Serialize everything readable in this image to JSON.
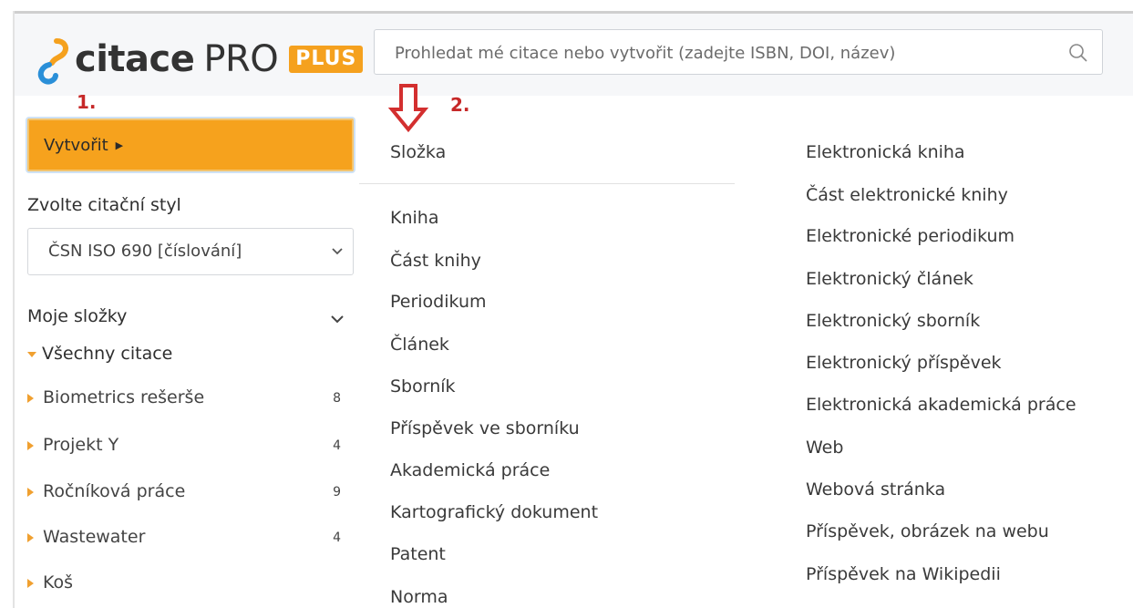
{
  "header": {
    "logo": {
      "name": "citace",
      "pro": "PRO",
      "badge": "PLUS"
    },
    "search": {
      "placeholder": "Prohledat mé citace nebo vytvořit (zadejte ISBN, DOI, název)"
    }
  },
  "annotations": {
    "step1": "1.",
    "step2": "2."
  },
  "sidebar": {
    "create_button": "Vytvořit",
    "style_label": "Zvolte citační styl",
    "style_value": "ČSN ISO 690 [číslování]",
    "folders_label": "Moje složky",
    "all_citations": "Všechny citace",
    "folders": [
      {
        "name": "Biometrics rešerše",
        "count": "8"
      },
      {
        "name": "Projekt Y",
        "count": "4"
      },
      {
        "name": "Ročníková práce",
        "count": "9"
      },
      {
        "name": "Wastewater",
        "count": "4"
      },
      {
        "name": "Koš",
        "count": ""
      }
    ]
  },
  "menu": {
    "folder": "Složka",
    "left": [
      "Kniha",
      "Část knihy",
      "Periodikum",
      "Článek",
      "Sborník",
      "Příspěvek ve sborníku",
      "Akademická práce",
      "Kartografický dokument",
      "Patent",
      "Norma"
    ],
    "right": [
      "Elektronická kniha",
      "Část elektronické knihy",
      "Elektronické periodikum",
      "Elektronický článek",
      "Elektronický sborník",
      "Elektronický příspěvek",
      "Elektronická akademická práce",
      "Web",
      "Webová stránka",
      "Příspěvek, obrázek na webu",
      "Příspěvek na Wikipedii"
    ]
  },
  "colors": {
    "accent": "#f6a21d",
    "annotation": "#c62828"
  }
}
